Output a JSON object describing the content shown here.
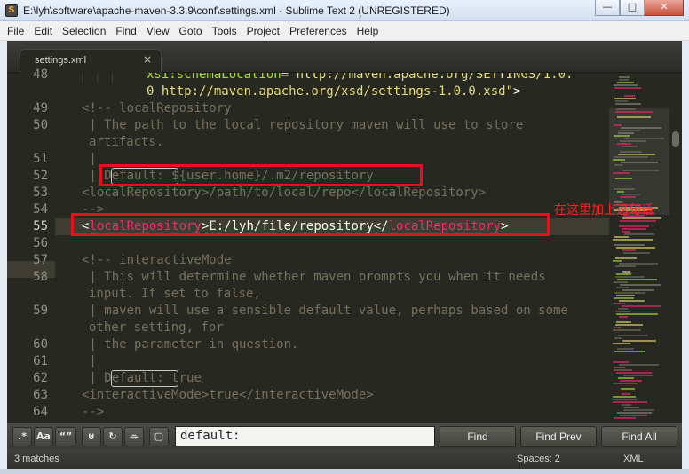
{
  "window": {
    "title": "E:\\lyh\\software\\apache-maven-3.3.9\\conf\\settings.xml - Sublime Text 2 (UNREGISTERED)",
    "minimize": "—",
    "maximize": "□",
    "close": "✕"
  },
  "menu": [
    "File",
    "Edit",
    "Selection",
    "Find",
    "View",
    "Goto",
    "Tools",
    "Project",
    "Preferences",
    "Help"
  ],
  "tab": {
    "label": "settings.xml",
    "close": "×"
  },
  "gutter": {
    "line_numbers": [
      "48",
      "",
      "49",
      "50",
      "",
      "51",
      "52",
      "53",
      "54",
      "55",
      "56",
      "57",
      "58",
      "",
      "59",
      "",
      "60",
      "61",
      "62",
      "63",
      "64"
    ],
    "current_line": "55"
  },
  "code": {
    "l48a_attr": "xsi:schemaLocation",
    "l48a_eq": "=",
    "l48a_str": "\"http://maven.apache.org/SETTINGS/1.0.",
    "l48b_str": "0 http://maven.apache.org/xsd/settings-1.0.0.xsd\"",
    "l48b_close": ">",
    "l49": "<!-- localRepository",
    "l50a": " | The path to the local repository maven will use to store",
    "l50b": "artifacts.",
    "l51": " |",
    "l52_pre": " | ",
    "l52_found": "Default:",
    "l52_rest": " ${user.home}/.m2/repository",
    "l53": "<localRepository>/path/to/local/repo</localRepository>",
    "l54": "-->",
    "l55_lt": "<",
    "l55_tag": "localRepository",
    "l55_gt": ">",
    "l55_text": "E:/lyh/file/repository",
    "l55_lt2": "</",
    "l55_tag2": "localRepository",
    "l55_gt2": ">",
    "l57": "<!-- interactiveMode",
    "l58a": " | This will determine whether maven prompts you when it needs",
    "l58b": "input. If set to false,",
    "l59a": " | maven will use a sensible default value, perhaps based on some",
    "l59b": "other setting, for",
    "l59c": " | the parameter in question.",
    "l61": " |",
    "l62_pre": " | ",
    "l62_found": "Default:",
    "l62_rest": " true",
    "l63": "<interactiveMode>true</interactiveMode>",
    "l64": "-->"
  },
  "annotation": {
    "text": "在这里加上这句话",
    "color": "#ff2020"
  },
  "find": {
    "options": [
      ".*",
      "Aa",
      "“”",
      "⊍",
      "↻",
      "⌯",
      "▢"
    ],
    "query": "default:",
    "buttons": {
      "find": "Find",
      "find_prev": "Find Prev",
      "find_all": "Find All"
    }
  },
  "status": {
    "matches": "3 matches",
    "spaces": "Spaces: 2",
    "syntax": "XML"
  },
  "colors": {
    "background": "#272822",
    "comment": "#75715e",
    "tag": "#f92672",
    "string": "#e6db74",
    "attribute": "#a6e22e",
    "highlight_box": "#e8101a"
  }
}
